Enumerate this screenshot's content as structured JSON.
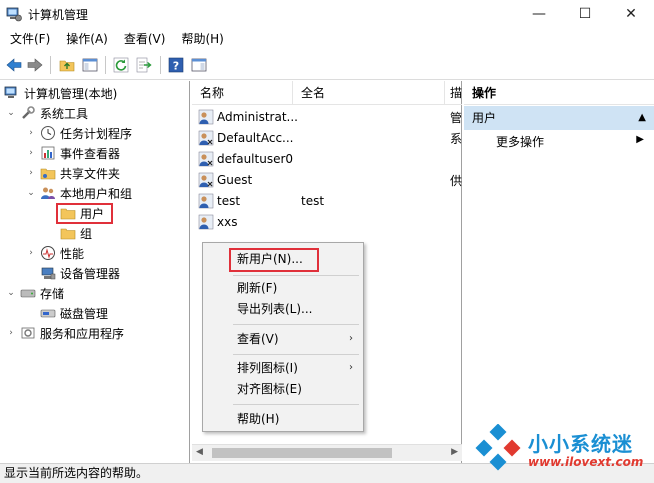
{
  "window": {
    "title": "计算机管理",
    "minimize_glyph": "—",
    "maximize_glyph": "☐",
    "close_glyph": "✕"
  },
  "menubar": {
    "items": [
      "文件(F)",
      "操作(A)",
      "查看(V)",
      "帮助(H)"
    ]
  },
  "toolbar": {
    "icons": [
      "back-arrow-icon",
      "forward-arrow-icon",
      "up-folder-icon",
      "show-hide-tree-icon",
      "refresh-icon",
      "export-list-icon",
      "help-icon",
      "properties-view-icon"
    ]
  },
  "tree": {
    "root": "计算机管理(本地)",
    "system_tools": "系统工具",
    "task_scheduler": "任务计划程序",
    "event_viewer": "事件查看器",
    "shared_folders": "共享文件夹",
    "local_users": "本地用户和组",
    "users": "用户",
    "groups": "组",
    "performance": "性能",
    "device_manager": "设备管理器",
    "storage": "存储",
    "disk_management": "磁盘管理",
    "services": "服务和应用程序"
  },
  "list": {
    "columns": [
      "名称",
      "全名",
      "描"
    ],
    "rows": [
      {
        "name": "Administrat...",
        "fullname": "",
        "desc": "管"
      },
      {
        "name": "DefaultAcc...",
        "fullname": "",
        "desc": "系"
      },
      {
        "name": "defaultuser0",
        "fullname": "",
        "desc": ""
      },
      {
        "name": "Guest",
        "fullname": "",
        "desc": "供"
      },
      {
        "name": "test",
        "fullname": "test",
        "desc": ""
      },
      {
        "name": "xxs",
        "fullname": "",
        "desc": ""
      }
    ]
  },
  "actions": {
    "header": "操作",
    "section": "用户",
    "more": "更多操作"
  },
  "context_menu": {
    "new_user": "新用户(N)...",
    "refresh": "刷新(F)",
    "export": "导出列表(L)...",
    "view": "查看(V)",
    "arrange": "排列图标(I)",
    "align": "对齐图标(E)",
    "help": "帮助(H)"
  },
  "status": {
    "text": "显示当前所选内容的帮助。"
  },
  "watermark": {
    "name": "小小系统迷",
    "url": "www.ilovext.com"
  },
  "colors": {
    "highlight_red": "#e0303a",
    "selection_blue": "#cfe3f4",
    "watermark_blue": "#1a8fd3",
    "watermark_red": "#e13a30"
  }
}
